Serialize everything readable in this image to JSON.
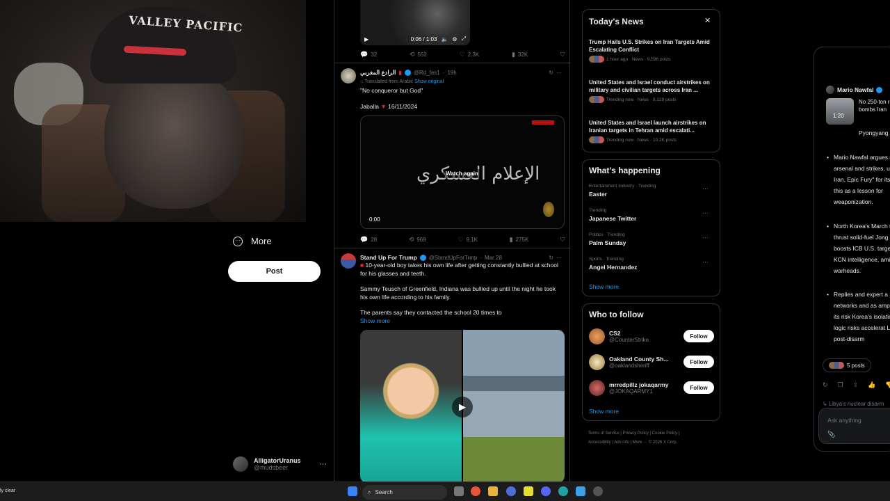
{
  "webcam": {
    "cap_text": "VALLEY PACIFIC"
  },
  "left_nav": {
    "more_label": "More",
    "post_label": "Post",
    "account_name": "AlligatorUranus",
    "account_handle": "@mudsbeer"
  },
  "feed": {
    "top_video": {
      "time": "0:06 / 1:03",
      "actions": {
        "replies": "32",
        "reposts": "552",
        "likes": "2.3K",
        "views": "32K"
      }
    },
    "tweet1": {
      "name": "الرادع المغربي",
      "handle": "@Rd_fas1",
      "time": "19h",
      "translated_label": "Translated from Arabic",
      "show_original": "Show original",
      "line1": "\"No conqueror but God\"",
      "line2": "Jaballa",
      "date": "16/11/2024",
      "video_watch": "Watch again",
      "video_time": "0:00",
      "actions": {
        "replies": "28",
        "reposts": "969",
        "likes": "9.1K",
        "views": "275K"
      }
    },
    "tweet2": {
      "name": "Stand Up For Trump",
      "handle": "@StandUpForTrmp",
      "time": "Mar 28",
      "p1": "10-year-old boy takes his own life after getting constantly bullied at school for his glasses and teeth.",
      "p2": "Sammy Teusch of Greenfield, Indiana was bullied up until the night he took his own life according to his family.",
      "p3": "The parents say they contacted the school 20 times to",
      "show_more": "Show more"
    }
  },
  "news": {
    "title": "Today's News",
    "items": [
      {
        "headline": "Trump Hails U.S. Strikes on Iran Targets Amid Escalating Conflict",
        "meta": "1 hour ago · News · 9,596 posts"
      },
      {
        "headline": "United States and Israel conduct airstrikes on military and civilian targets across Iran ...",
        "meta": "Trending now · News · 8,129 posts"
      },
      {
        "headline": "United States and Israel launch airstrikes on Iranian targets in Tehran amid escalati...",
        "meta": "Trending now · News · 10.2K posts"
      }
    ]
  },
  "happening": {
    "title": "What's happening",
    "trends": [
      {
        "context": "Entertainment Industry · Trending",
        "name": "Easter"
      },
      {
        "context": "Trending",
        "name": "Japanese Twitter"
      },
      {
        "context": "Politics · Trending",
        "name": "Palm Sunday"
      },
      {
        "context": "Sports · Trending",
        "name": "Angel Hernandez"
      }
    ],
    "show_more": "Show more"
  },
  "who_to_follow": {
    "title": "Who to follow",
    "accounts": [
      {
        "name": "CS2",
        "handle": "@CounterStrike",
        "button": "Follow"
      },
      {
        "name": "Oakland County Sh...",
        "handle": "@oaklandsheriff",
        "button": "Follow"
      },
      {
        "name": "mrredpillz jokaqarmy",
        "handle": "@JOKAQARMY1",
        "button": "Follow"
      }
    ],
    "show_more": "Show more"
  },
  "footer": {
    "line1": "Terms of Service  |  Privacy Policy  |  Cookie Policy  |",
    "line2": "Accessibility  |  Ads info  |  More ···  © 2026 X Corp."
  },
  "grok": {
    "card_author": "Mario Nawfal",
    "card_text": "No 250-ton roc bombs Iran",
    "card_sub": "Pyongyang",
    "thumb_time": "1:20",
    "bullets": [
      "Mario Nawfal argues nuclear arsenal and strikes, unlike Iran, Epic Fury\" for its pre this as a lesson for weaponization.",
      "North Korea's March ton thrust solid-fuel Jong Un, boosts ICB U.S. targets, per KCN intelligence, amid its warheads.",
      "Replies and expert a proxy networks and as amplifying its risk Korea's isolation, yet logic risks accelerat Libya's post-disarm"
    ],
    "posts_pill": "5 posts",
    "followup": "Libya's nuclear disarm",
    "input_placeholder": "Ask anything"
  },
  "taskbar": {
    "search_placeholder": "Search",
    "weather": "ly clear"
  }
}
